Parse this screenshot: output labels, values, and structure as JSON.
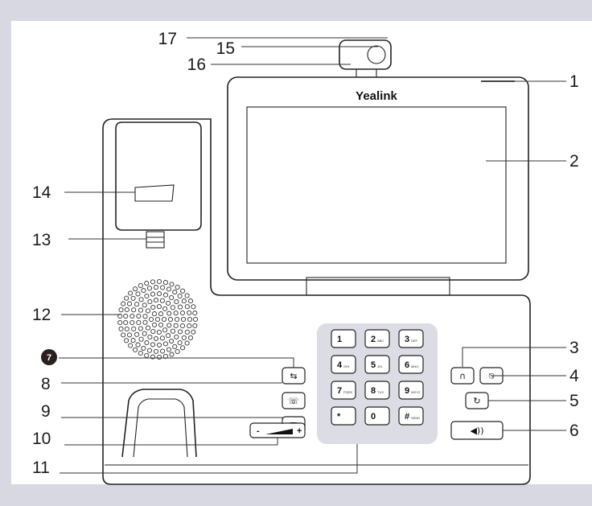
{
  "brand": "Yealink",
  "callouts": {
    "c1": "1",
    "c2": "2",
    "c3": "3",
    "c4": "4",
    "c5": "5",
    "c6": "6",
    "c7": "7",
    "c8": "8",
    "c9": "9",
    "c10": "10",
    "c11": "11",
    "c12": "12",
    "c13": "13",
    "c14": "14",
    "c15": "15",
    "c16": "16",
    "c17": "17"
  },
  "keypad": {
    "k1": "1",
    "k1s": "",
    "k2": "2",
    "k2s": "ABC",
    "k3": "3",
    "k3s": "DEF",
    "k4": "4",
    "k4s": "GHI",
    "k5": "5",
    "k5s": "JKL",
    "k6": "6",
    "k6s": "MNO",
    "k7": "7",
    "k7s": "PQRS",
    "k8": "8",
    "k8s": "TUV",
    "k9": "9",
    "k9s": "WXYZ",
    "kstar": "*",
    "kstars": ".",
    "k0": "0",
    "k0s": "",
    "khash": "#",
    "khashs": "SEND"
  },
  "volume": {
    "minus": "-",
    "plus": "+"
  },
  "icons": {
    "headset": "headset-icon",
    "mute": "mute-icon",
    "redial": "redial-icon",
    "speaker": "speakerphone-icon",
    "transfer": "transfer-icon",
    "conference": "conference-icon",
    "message": "message-icon"
  }
}
